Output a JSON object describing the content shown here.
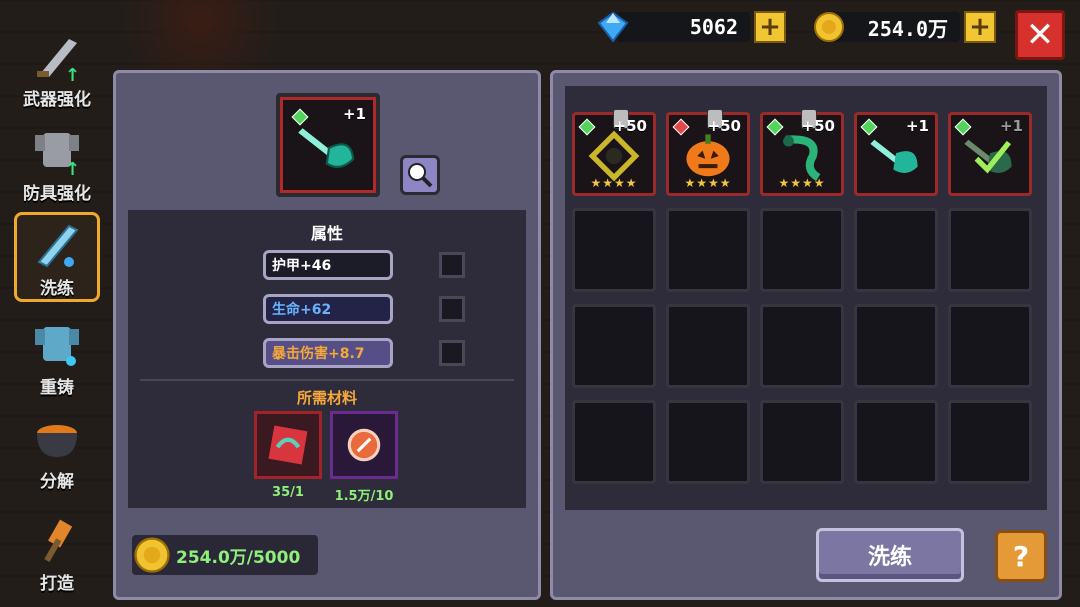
{
  "currency": {
    "diamonds": "5062",
    "coins": "254.0万"
  },
  "sidebar": {
    "items": [
      {
        "label": "武器强化",
        "icon": "sword-upgrade-icon"
      },
      {
        "label": "防具强化",
        "icon": "armor-upgrade-icon"
      },
      {
        "label": "洗练",
        "icon": "refine-sword-icon",
        "active": true
      },
      {
        "label": "重铸",
        "icon": "recast-armor-icon"
      },
      {
        "label": "分解",
        "icon": "cauldron-icon"
      },
      {
        "label": "打造",
        "icon": "forge-hammer-icon"
      }
    ]
  },
  "selected": {
    "plus": "+1"
  },
  "attributes": {
    "title": "属性",
    "items": [
      {
        "label": "护甲+46",
        "color": "#ffffff"
      },
      {
        "label": "生命+62",
        "color": "#6ab4ff"
      },
      {
        "label": "暴击伤害+8.7",
        "color": "#f5a83a"
      }
    ]
  },
  "materials": {
    "title": "所需材料",
    "items": [
      {
        "count": "35/1",
        "icon": "red-material-icon"
      },
      {
        "count": "1.5万/10",
        "icon": "orange-orb-icon"
      }
    ]
  },
  "cost": "254.0万/5000",
  "inventory": [
    {
      "plus": "+50",
      "icon": "gold-ring-icon",
      "stars": "★★★★",
      "gem": "green"
    },
    {
      "plus": "+50",
      "icon": "pumpkin-icon",
      "stars": "★★★★",
      "gem": "red"
    },
    {
      "plus": "+50",
      "icon": "snake-icon",
      "stars": "★★★★",
      "gem": "green"
    },
    {
      "plus": "+1",
      "icon": "cyan-weapon-icon",
      "gem": "green"
    },
    {
      "plus": "+1",
      "icon": "green-weapon-icon",
      "gem": "green"
    }
  ],
  "buttons": {
    "wash": "洗练",
    "help": "?"
  },
  "colors": {
    "accent": "#f0a92b",
    "panel": "#5a5770",
    "close": "#d6312d"
  }
}
